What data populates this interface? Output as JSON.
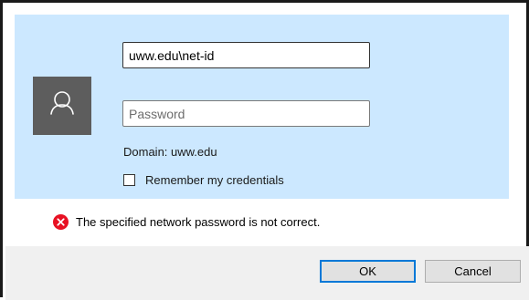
{
  "credentials": {
    "username_value": "uww.edu\\net-id",
    "password_placeholder": "Password",
    "domain_text": "Domain: uww.edu",
    "remember_label": "Remember my credentials",
    "remember_checked": false
  },
  "error": {
    "message": "The specified network password is not correct.",
    "icon": "error-icon"
  },
  "buttons": {
    "ok_label": "OK",
    "cancel_label": "Cancel"
  },
  "colors": {
    "panel_background": "#cce8ff",
    "avatar_background": "#5d5d5d",
    "error_red": "#e81123",
    "default_button_border": "#0078d7",
    "button_bar_background": "#f0f0f0"
  }
}
